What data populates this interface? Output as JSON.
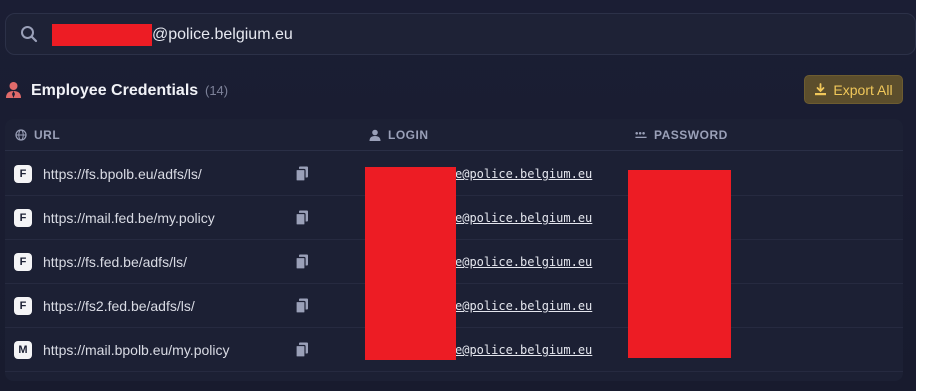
{
  "search": {
    "query_suffix": "@police.belgium.eu",
    "icon": "search-icon"
  },
  "header": {
    "title": "Employee Credentials",
    "count": "(14)",
    "export_label": "Export All"
  },
  "colors": {
    "accent": "#f0c75a",
    "background": "#1b1e34",
    "redaction": "#ed1c24"
  },
  "table": {
    "columns": {
      "url": "URL",
      "login": "LOGIN",
      "password": "PASSWORD"
    },
    "rows": [
      {
        "badge": "F",
        "url": "https://fs.bpolb.eu/adfs/ls/",
        "login": "e@police.belgium.eu"
      },
      {
        "badge": "F",
        "url": "https://mail.fed.be/my.policy",
        "login": "e@police.belgium.eu"
      },
      {
        "badge": "F",
        "url": "https://fs.fed.be/adfs/ls/",
        "login": "e@police.belgium.eu"
      },
      {
        "badge": "F",
        "url": "https://fs2.fed.be/adfs/ls/",
        "login": "e@police.belgium.eu"
      },
      {
        "badge": "M",
        "url": "https://mail.bpolb.eu/my.policy",
        "login": "e@police.belgium.eu"
      }
    ]
  }
}
